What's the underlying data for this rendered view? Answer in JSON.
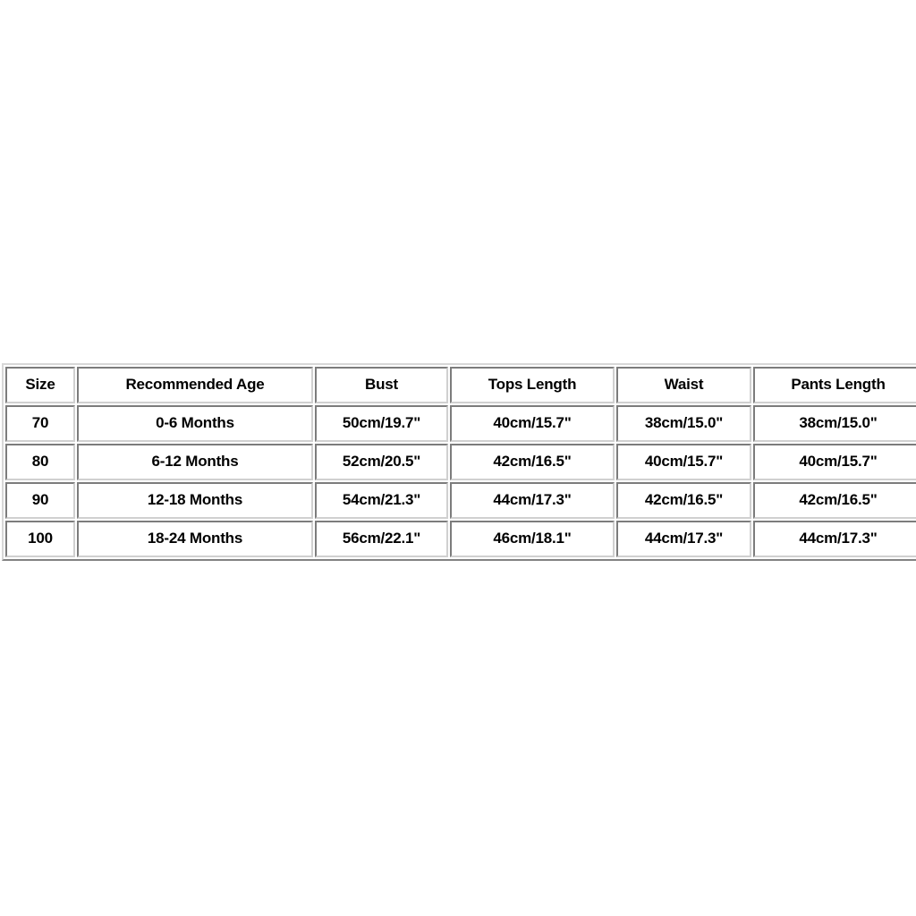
{
  "page": {
    "background_color": "#ffffff",
    "text_color": "#000000",
    "border_color": "#d0d0d0"
  },
  "chart_data": {
    "type": "table",
    "title": "",
    "columns": [
      "Size",
      "Recommended Age",
      "Bust",
      "Tops Length",
      "Waist",
      "Pants Length"
    ],
    "rows": [
      [
        "70",
        "0-6 Months",
        "50cm/19.7\"",
        "40cm/15.7\"",
        "38cm/15.0\"",
        "38cm/15.0\""
      ],
      [
        "80",
        "6-12 Months",
        "52cm/20.5\"",
        "42cm/16.5\"",
        "40cm/15.7\"",
        "40cm/15.7\""
      ],
      [
        "90",
        "12-18 Months",
        "54cm/21.3\"",
        "44cm/17.3\"",
        "42cm/16.5\"",
        "42cm/16.5\""
      ],
      [
        "100",
        "18-24 Months",
        "56cm/22.1\"",
        "46cm/18.1\"",
        "44cm/17.3\"",
        "44cm/17.3\""
      ]
    ]
  },
  "table": {
    "header": {
      "size": "Size",
      "recommended_age": "Recommended Age",
      "bust": "Bust",
      "tops_length": "Tops Length",
      "waist": "Waist",
      "pants_length": "Pants Length"
    },
    "rows": [
      {
        "size": "70",
        "recommended_age": "0-6 Months",
        "bust": "50cm/19.7\"",
        "tops_length": "40cm/15.7\"",
        "waist": "38cm/15.0\"",
        "pants_length": "38cm/15.0\""
      },
      {
        "size": "80",
        "recommended_age": "6-12 Months",
        "bust": "52cm/20.5\"",
        "tops_length": "42cm/16.5\"",
        "waist": "40cm/15.7\"",
        "pants_length": "40cm/15.7\""
      },
      {
        "size": "90",
        "recommended_age": "12-18 Months",
        "bust": "54cm/21.3\"",
        "tops_length": "44cm/17.3\"",
        "waist": "42cm/16.5\"",
        "pants_length": "42cm/16.5\""
      },
      {
        "size": "100",
        "recommended_age": "18-24 Months",
        "bust": "56cm/22.1\"",
        "tops_length": "46cm/18.1\"",
        "waist": "44cm/17.3\"",
        "pants_length": "44cm/17.3\""
      }
    ]
  }
}
